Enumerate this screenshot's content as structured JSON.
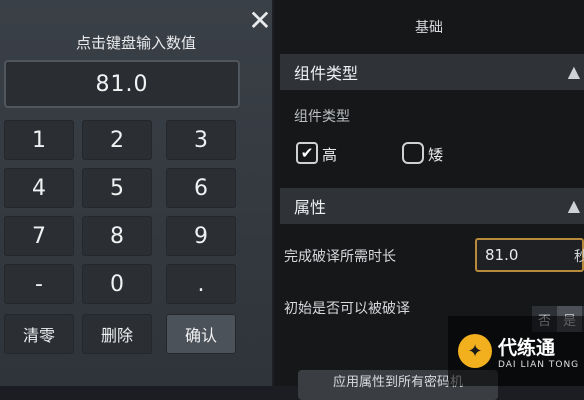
{
  "keypad": {
    "title": "点击键盘输入数值",
    "display_value": "81.0",
    "close_label": "✕",
    "keys": [
      "1",
      "2",
      "3",
      "4",
      "5",
      "6",
      "7",
      "8",
      "9",
      "-",
      "0",
      "."
    ],
    "clear_label": "清零",
    "delete_label": "删除",
    "confirm_label": "确认"
  },
  "settings": {
    "tab_title": "基础",
    "component_section": {
      "title": "组件类型",
      "row_label": "组件类型",
      "options": [
        {
          "label": "高",
          "checked": true
        },
        {
          "label": "矮",
          "checked": false
        }
      ]
    },
    "attribute_section": {
      "title": "属性",
      "duration_label": "完成破译所需时长",
      "duration_value": "81.0",
      "duration_unit": "秒",
      "crackable_label": "初始是否可以被破译",
      "crackable_options": [
        "否",
        "是"
      ],
      "crackable_selected": "是"
    },
    "apply_label": "应用属性到所有密码机"
  },
  "watermark": {
    "text_cn": "代练通",
    "text_en": "DAI LIAN TONG"
  },
  "colors": {
    "accent_border": "#b88a3c",
    "panel_bg": "#2f343a",
    "watermark_logo": "#f2b01e"
  }
}
